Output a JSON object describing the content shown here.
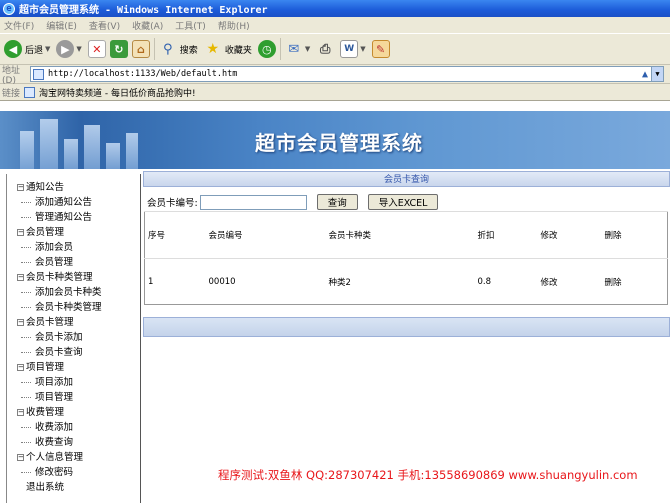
{
  "window": {
    "title": "超市会员管理系统 - Windows Internet Explorer"
  },
  "menubar": {
    "items": [
      "文件(F)",
      "编辑(E)",
      "查看(V)",
      "收藏(A)",
      "工具(T)",
      "帮助(H)"
    ]
  },
  "toolbar": {
    "back_label": "后退",
    "search_label": "搜索",
    "favorites_label": "收藏夹"
  },
  "address": {
    "label": "地址(D)",
    "url": "http://localhost:1133/Web/default.htm"
  },
  "links": {
    "label": "链接",
    "item": "淘宝网特卖频道 - 每日低价商品抢购中!"
  },
  "banner": {
    "title": "超市会员管理系统"
  },
  "sidebar": {
    "groups": [
      {
        "label": "通知公告",
        "children": [
          "添加通知公告",
          "管理通知公告"
        ]
      },
      {
        "label": "会员管理",
        "children": [
          "添加会员",
          "会员管理"
        ]
      },
      {
        "label": "会员卡种类管理",
        "children": [
          "添加会员卡种类",
          "会员卡种类管理"
        ]
      },
      {
        "label": "会员卡管理",
        "children": [
          "会员卡添加",
          "会员卡查询"
        ]
      },
      {
        "label": "项目管理",
        "children": [
          "项目添加",
          "项目管理"
        ]
      },
      {
        "label": "收费管理",
        "children": [
          "收费添加",
          "收费查询"
        ]
      },
      {
        "label": "个人信息管理",
        "children": [
          "修改密码"
        ]
      }
    ],
    "logout": "退出系统"
  },
  "panel": {
    "title": "会员卡查询",
    "search_label": "会员卡编号:",
    "search_value": "",
    "query_button": "查询",
    "export_button": "导入EXCEL",
    "columns": [
      "序号",
      "会员编号",
      "会员卡种类",
      "折扣",
      "修改",
      "删除"
    ],
    "rows": [
      [
        "1",
        "00010",
        "种类2",
        "0.8",
        "修改",
        "删除"
      ]
    ]
  },
  "footer": {
    "text": "程序测试:双鱼林 QQ:287307421 手机:13558690869 www.shuangyulin.com"
  }
}
